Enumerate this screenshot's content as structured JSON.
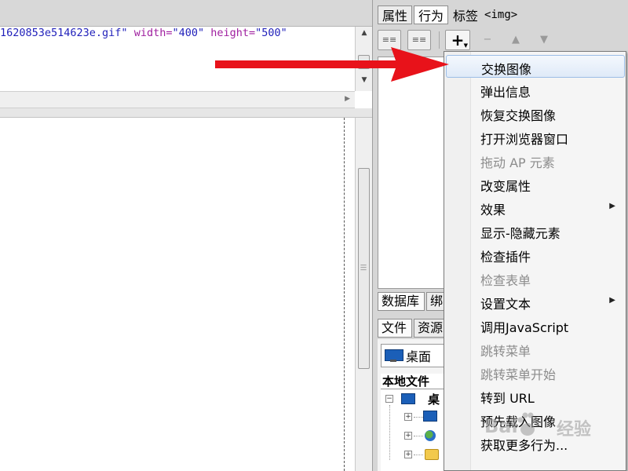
{
  "code": {
    "line_value": "1620853e514623e.gif\"",
    "attr_width_name": " width=",
    "attr_width_value": "\"400\"",
    "attr_height_name": " height=",
    "attr_height_value": "\"500\""
  },
  "panel": {
    "tabs": [
      {
        "label": "属性",
        "active": false
      },
      {
        "label": "行为",
        "active": true
      }
    ],
    "tag_title": "标签",
    "tag_name": "<img>",
    "toolbar": {
      "plus_label": "+",
      "minus_label": "−",
      "up_label": "▲",
      "down_label": "▼"
    }
  },
  "lower_tabs": {
    "row1": [
      "数据库",
      "绑"
    ],
    "row2": [
      "文件",
      "资源"
    ]
  },
  "files": {
    "location": "桌面",
    "header": "本地文件",
    "root_label": "桌"
  },
  "menu": {
    "items": [
      {
        "label": "交换图像",
        "disabled": false,
        "submenu": false,
        "highlight": true
      },
      {
        "label": "弹出信息",
        "disabled": false,
        "submenu": false,
        "highlight": false
      },
      {
        "label": "恢复交换图像",
        "disabled": false,
        "submenu": false,
        "highlight": false
      },
      {
        "label": "打开浏览器窗口",
        "disabled": false,
        "submenu": false,
        "highlight": false
      },
      {
        "label": "拖动 AP 元素",
        "disabled": true,
        "submenu": false,
        "highlight": false
      },
      {
        "label": "改变属性",
        "disabled": false,
        "submenu": false,
        "highlight": false
      },
      {
        "label": "效果",
        "disabled": false,
        "submenu": true,
        "highlight": false
      },
      {
        "label": "显示-隐藏元素",
        "disabled": false,
        "submenu": false,
        "highlight": false
      },
      {
        "label": "检查插件",
        "disabled": false,
        "submenu": false,
        "highlight": false
      },
      {
        "label": "检查表单",
        "disabled": true,
        "submenu": false,
        "highlight": false
      },
      {
        "label": "设置文本",
        "disabled": false,
        "submenu": true,
        "highlight": false
      },
      {
        "label": "调用JavaScript",
        "disabled": false,
        "submenu": false,
        "highlight": false
      },
      {
        "label": "跳转菜单",
        "disabled": true,
        "submenu": false,
        "highlight": false
      },
      {
        "label": "跳转菜单开始",
        "disabled": true,
        "submenu": false,
        "highlight": false
      },
      {
        "label": "转到 URL",
        "disabled": false,
        "submenu": false,
        "highlight": false
      },
      {
        "label": "预先载入图像",
        "disabled": false,
        "submenu": false,
        "highlight": false
      },
      {
        "label": "获取更多行为...",
        "disabled": false,
        "submenu": false,
        "highlight": false
      }
    ]
  },
  "watermark": {
    "text_left": "Bai",
    "text_right": "经验"
  },
  "icons": {
    "annotation": "red-arrow-icon",
    "submenu": "chevron-right-icon",
    "location": "monitor-icon"
  },
  "colors": {
    "arrow": "#e8121a",
    "menu_highlight_border": "#9cbde6",
    "code_value": "#2222bb",
    "code_attr": "#a020a0"
  }
}
